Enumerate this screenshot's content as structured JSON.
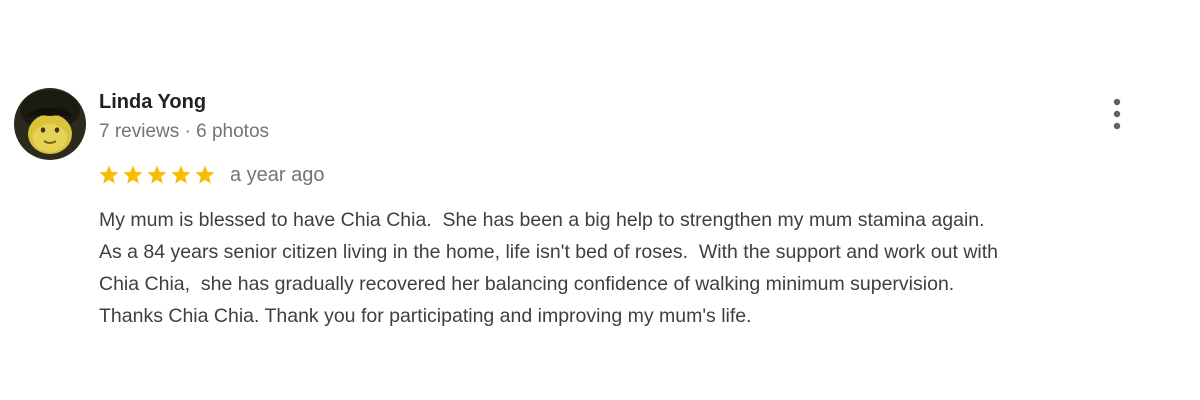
{
  "reviewer": {
    "name": "Linda Yong",
    "meta": "7 reviews · 6 photos",
    "avatar_icon": "profile-photo-icon"
  },
  "rating": {
    "stars": 5,
    "max_stars": 5,
    "star_color": "#fbbc04",
    "date": "a year ago"
  },
  "review": {
    "lines": [
      "My mum is blessed to have Chia Chia.  She has been a big help to strengthen my mum stamina again.",
      "As a 84 years senior citizen living in the home, life isn't bed of roses.  With the support and work out with",
      "Chia Chia,  she has gradually recovered her balancing confidence of walking minimum supervision.",
      "Thanks Chia Chia. Thank you for participating and improving my mum's life."
    ]
  },
  "actions": {
    "more_icon": "more-vertical-icon"
  },
  "colors": {
    "name_text": "#202124",
    "meta_text": "#70757a",
    "body_text": "#3c4043"
  }
}
